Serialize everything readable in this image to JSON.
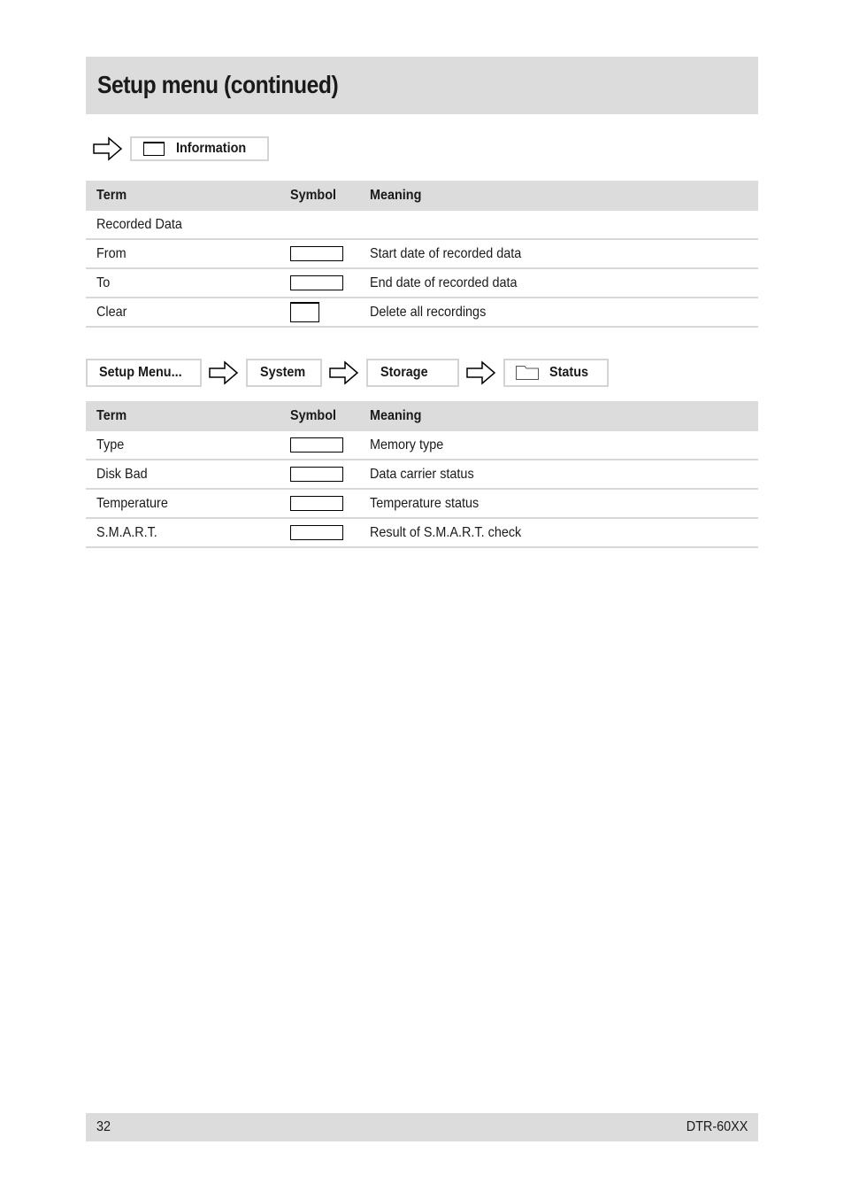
{
  "page": {
    "title": "Setup menu (continued)"
  },
  "section1": {
    "path": [
      {
        "label": "Information",
        "icon": "window-icon"
      }
    ],
    "table": {
      "headers": [
        "Term",
        "Symbol",
        "Meaning"
      ],
      "rows": [
        {
          "term": "Recorded Data",
          "symbol": "",
          "meaning": ""
        },
        {
          "term": "From",
          "symbol": "wide-box",
          "meaning": "Start date of recorded data"
        },
        {
          "term": "To",
          "symbol": "wide-box",
          "meaning": "End date of recorded data"
        },
        {
          "term": "Clear",
          "symbol": "small-box",
          "meaning": "Delete all recordings"
        }
      ]
    }
  },
  "section2": {
    "path": [
      {
        "label": "Setup Menu..."
      },
      {
        "label": "System"
      },
      {
        "label": "Storage"
      },
      {
        "label": "Status",
        "icon": "folder-icon"
      }
    ],
    "table": {
      "headers": [
        "Term",
        "Symbol",
        "Meaning"
      ],
      "rows": [
        {
          "term": "Type",
          "symbol": "wide-box",
          "meaning": "Memory type"
        },
        {
          "term": "Disk Bad",
          "symbol": "wide-box",
          "meaning": "Data carrier status"
        },
        {
          "term": "Temperature",
          "symbol": "wide-box",
          "meaning": "Temperature status"
        },
        {
          "term": "S.M.A.R.T.",
          "symbol": "wide-box",
          "meaning": "Result of S.M.A.R.T. check"
        }
      ]
    }
  },
  "footer": {
    "page_number": "32",
    "model": "DTR-60XX"
  }
}
